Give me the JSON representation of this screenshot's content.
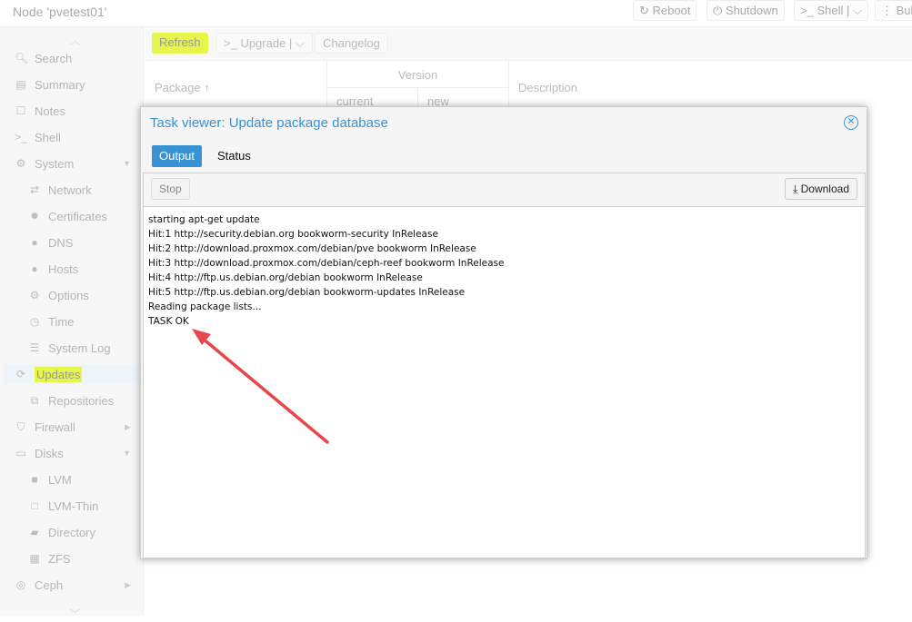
{
  "header": {
    "title": "Node 'pvetest01'",
    "buttons": [
      "Reboot",
      "Shutdown",
      "Shell",
      "Bulk Actions"
    ]
  },
  "sidebar": {
    "items": [
      {
        "label": "Search",
        "icon": "search-icon"
      },
      {
        "label": "Summary",
        "icon": "book-icon"
      },
      {
        "label": "Notes",
        "icon": "note-icon"
      },
      {
        "label": "Shell",
        "icon": "terminal-icon"
      },
      {
        "label": "System",
        "icon": "gears-icon"
      },
      {
        "label": "Network",
        "icon": "exchange-icon"
      },
      {
        "label": "Certificates",
        "icon": "certificate-icon"
      },
      {
        "label": "DNS",
        "icon": "globe-icon"
      },
      {
        "label": "Hosts",
        "icon": "globe-icon"
      },
      {
        "label": "Options",
        "icon": "gear-icon"
      },
      {
        "label": "Time",
        "icon": "clock-icon"
      },
      {
        "label": "System Log",
        "icon": "list-icon"
      },
      {
        "label": "Updates",
        "icon": "refresh-icon"
      },
      {
        "label": "Repositories",
        "icon": "files-icon"
      },
      {
        "label": "Firewall",
        "icon": "shield-icon"
      },
      {
        "label": "Disks",
        "icon": "hdd-icon"
      },
      {
        "label": "LVM",
        "icon": "square-icon"
      },
      {
        "label": "LVM-Thin",
        "icon": "square-o-icon"
      },
      {
        "label": "Directory",
        "icon": "folder-icon"
      },
      {
        "label": "ZFS",
        "icon": "th-large-icon"
      },
      {
        "label": "Ceph",
        "icon": "ceph-icon"
      }
    ]
  },
  "toolbar": {
    "refresh": "Refresh",
    "upgrade": "Upgrade",
    "changelog": "Changelog"
  },
  "grid": {
    "package": "Package",
    "version": "Version",
    "current": "current",
    "new": "new",
    "description": "Description"
  },
  "dialog": {
    "title": "Task viewer: Update package database",
    "tabs": [
      "Output",
      "Status"
    ],
    "stop": "Stop",
    "download": "Download",
    "log": [
      "starting apt-get update",
      "Hit:1 http://security.debian.org bookworm-security InRelease",
      "Hit:2 http://download.proxmox.com/debian/pve bookworm InRelease",
      "Hit:3 http://download.proxmox.com/debian/ceph-reef bookworm InRelease",
      "Hit:4 http://ftp.us.debian.org/debian bookworm InRelease",
      "Hit:5 http://ftp.us.debian.org/debian bookworm-updates InRelease",
      "Reading package lists...",
      "TASK OK"
    ]
  },
  "colors": {
    "accent": "#3892d4",
    "highlight": "#e6f54a",
    "arrow": "#e8474a"
  }
}
